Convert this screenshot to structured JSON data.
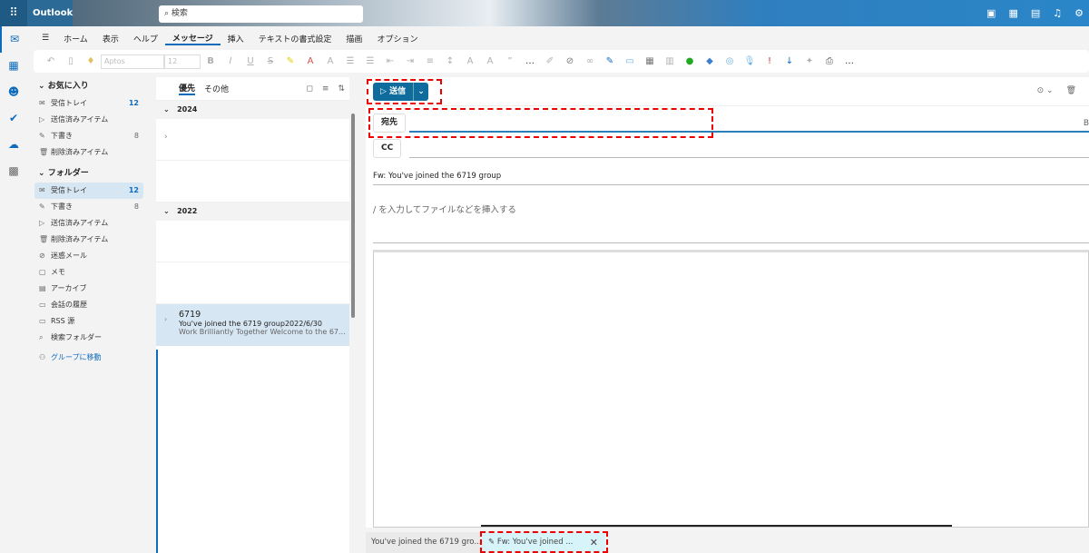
{
  "header": {
    "app": "Outlook",
    "search_placeholder": "検索",
    "icons": [
      "chat-icon",
      "word-icon",
      "notes-icon",
      "bell-icon",
      "gear-icon"
    ]
  },
  "ribbon": {
    "tabs": [
      "ホーム",
      "表示",
      "ヘルプ",
      "メッセージ",
      "挿入",
      "テキストの書式設定",
      "描画",
      "オプション"
    ],
    "active": "メッセージ",
    "font": "Aptos",
    "size": "12"
  },
  "folders": {
    "favorites_label": "お気に入り",
    "favorites": [
      {
        "icon": "✉",
        "label": "受信トレイ",
        "count": "12"
      },
      {
        "icon": "▷",
        "label": "送信済みアイテム",
        "count": ""
      },
      {
        "icon": "✎",
        "label": "下書き",
        "count": "8"
      },
      {
        "icon": "🗑",
        "label": "削除済みアイテム",
        "count": ""
      }
    ],
    "folders_label": "フォルダー",
    "items": [
      {
        "icon": "✉",
        "label": "受信トレイ",
        "count": "12"
      },
      {
        "icon": "✎",
        "label": "下書き",
        "count": "8"
      },
      {
        "icon": "▷",
        "label": "送信済みアイテム",
        "count": ""
      },
      {
        "icon": "🗑",
        "label": "削除済みアイテム",
        "count": ""
      },
      {
        "icon": "⊘",
        "label": "迷惑メール",
        "count": ""
      },
      {
        "icon": "▢",
        "label": "メモ",
        "count": ""
      },
      {
        "icon": "▤",
        "label": "アーカイブ",
        "count": ""
      },
      {
        "icon": "▭",
        "label": "会話の履歴",
        "count": ""
      },
      {
        "icon": "▭",
        "label": "RSS 源",
        "count": ""
      },
      {
        "icon": "⌕",
        "label": "検索フォルダー",
        "count": ""
      }
    ],
    "groups_link": "グループに移動"
  },
  "list": {
    "tab_focused": "優先",
    "tab_other": "その他",
    "group1": "2024",
    "group2": "2022",
    "message": {
      "sender": "6719",
      "subject": "You've joined the 6719 group",
      "date": "2022/6/30",
      "preview": "Work Brilliantly Together Welcome to the 67..."
    }
  },
  "compose": {
    "send": "送信",
    "to": "宛先",
    "cc": "CC",
    "subject": "Fw: You've joined the 6719 group",
    "body_placeholder": "/ を入力してファイルなどを挿入する",
    "bcc_hint": "B"
  },
  "bottom_tabs": {
    "tab1": "You've joined the 6719 gro...",
    "tab2": "Fw: You've joined ..."
  }
}
